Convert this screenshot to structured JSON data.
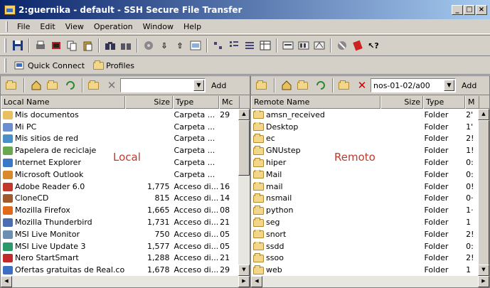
{
  "window": {
    "title": "2:guernika - default - SSH Secure File Transfer",
    "buttons": {
      "minimize": "_",
      "restore": "□",
      "close": "×"
    }
  },
  "menu": [
    "File",
    "Edit",
    "View",
    "Operation",
    "Window",
    "Help"
  ],
  "quick_bar": {
    "quick_connect": "Quick Connect",
    "profiles": "Profiles"
  },
  "local": {
    "path_value": "",
    "add_label": "Add",
    "overlay": "Local",
    "columns": [
      "Local Name",
      "Size",
      "Type",
      "Mc"
    ],
    "rows": [
      {
        "name": "Mis documentos",
        "size": "",
        "type": "Carpeta ...",
        "mod": "29"
      },
      {
        "name": "Mi PC",
        "size": "",
        "type": "Carpeta ...",
        "mod": ""
      },
      {
        "name": "Mis sitios de red",
        "size": "",
        "type": "Carpeta ...",
        "mod": ""
      },
      {
        "name": "Papelera de reciclaje",
        "size": "",
        "type": "Carpeta ...",
        "mod": ""
      },
      {
        "name": "Internet Explorer",
        "size": "",
        "type": "Carpeta ...",
        "mod": ""
      },
      {
        "name": "Microsoft Outlook",
        "size": "",
        "type": "Carpeta ...",
        "mod": ""
      },
      {
        "name": "Adobe Reader 6.0",
        "size": "1,775",
        "type": "Acceso di...",
        "mod": "16"
      },
      {
        "name": "CloneCD",
        "size": "815",
        "type": "Acceso di...",
        "mod": "14"
      },
      {
        "name": "Mozilla Firefox",
        "size": "1,665",
        "type": "Acceso di...",
        "mod": "08"
      },
      {
        "name": "Mozilla Thunderbird",
        "size": "1,731",
        "type": "Acceso di...",
        "mod": "21"
      },
      {
        "name": "MSI Live Monitor",
        "size": "750",
        "type": "Acceso di...",
        "mod": "05"
      },
      {
        "name": "MSI Live Update 3",
        "size": "1,577",
        "type": "Acceso di...",
        "mod": "05"
      },
      {
        "name": "Nero StartSmart",
        "size": "1,288",
        "type": "Acceso di...",
        "mod": "21"
      },
      {
        "name": "Ofertas gratuitas de Real.com",
        "size": "1,678",
        "type": "Acceso di...",
        "mod": "29"
      }
    ]
  },
  "remote": {
    "path_value": "nos-01-02/a00",
    "add_label": "Add",
    "overlay": "Remoto",
    "columns": [
      "Remote Name",
      "Size",
      "Type",
      "M"
    ],
    "rows": [
      {
        "name": "amsn_received",
        "type": "Folder",
        "mod": "2'"
      },
      {
        "name": "Desktop",
        "type": "Folder",
        "mod": "1'"
      },
      {
        "name": "ec",
        "type": "Folder",
        "mod": "2!"
      },
      {
        "name": "GNUstep",
        "type": "Folder",
        "mod": "1!"
      },
      {
        "name": "hiper",
        "type": "Folder",
        "mod": "0:"
      },
      {
        "name": "Mail",
        "type": "Folder",
        "mod": "0:"
      },
      {
        "name": "mail",
        "type": "Folder",
        "mod": "0!"
      },
      {
        "name": "nsmail",
        "type": "Folder",
        "mod": "0·"
      },
      {
        "name": "python",
        "type": "Folder",
        "mod": "1·"
      },
      {
        "name": "seg",
        "type": "Folder",
        "mod": "1"
      },
      {
        "name": "snort",
        "type": "Folder",
        "mod": "2!"
      },
      {
        "name": "ssdd",
        "type": "Folder",
        "mod": "0:"
      },
      {
        "name": "ssoo",
        "type": "Folder",
        "mod": "2!"
      },
      {
        "name": "web",
        "type": "Folder",
        "mod": "1"
      }
    ]
  }
}
